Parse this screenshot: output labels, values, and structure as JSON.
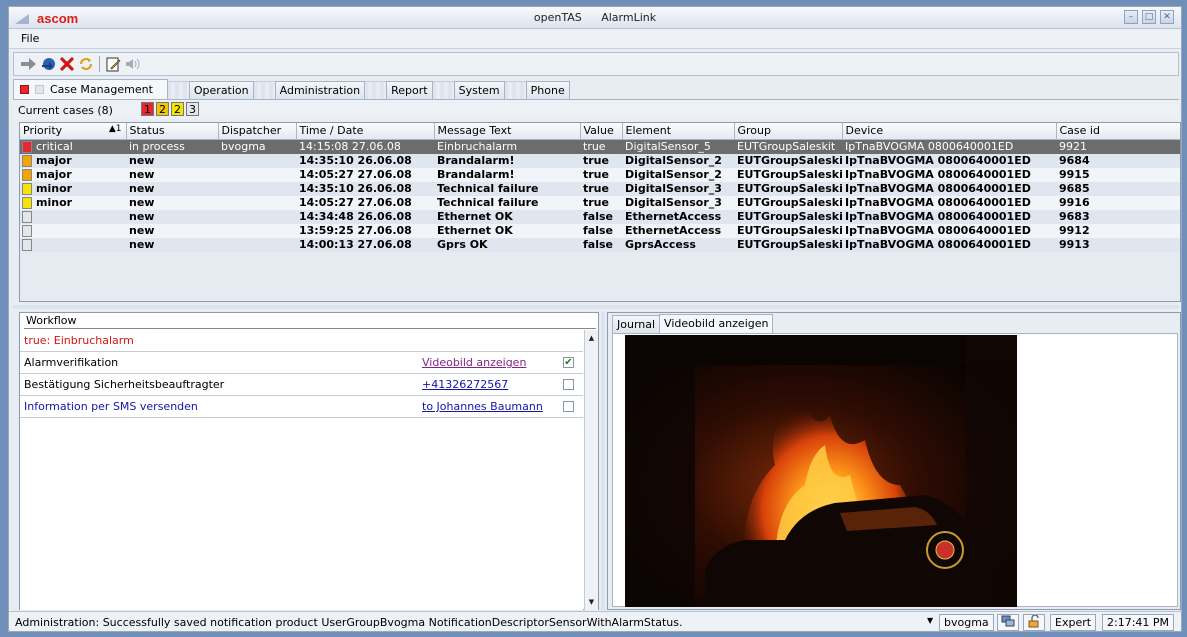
{
  "titlebar": {
    "brand": "ascom",
    "app_name": "openTAS",
    "module_name": "AlarmLink"
  },
  "menu": {
    "file": "File"
  },
  "tabs": [
    "Case Management",
    "Operation",
    "Administration",
    "Report",
    "System",
    "Phone"
  ],
  "current_cases": {
    "label": "Current cases (8)",
    "badges": [
      {
        "text": "1",
        "color": "#e8262d"
      },
      {
        "text": "2",
        "color": "#f4c400"
      },
      {
        "text": "2",
        "color": "#f4e500"
      },
      {
        "text": "3",
        "color": "#e3e6ea"
      }
    ]
  },
  "table": {
    "columns": [
      "Priority",
      "Status",
      "Dispatcher",
      "Time / Date",
      "Message Text",
      "Value",
      "Element",
      "Group",
      "Device",
      "Case id"
    ],
    "sort_indicator": "▲1",
    "rows": [
      {
        "priority": "critical",
        "status": "in process",
        "dispatcher": "bvogma",
        "time": "14:15:08 27.06.08",
        "message": "Einbruchalarm",
        "value": "true",
        "element": "DigitalSensor_5",
        "group": "EUTGroupSaleskit",
        "device": "IpTnaBVOGMA 0800640001ED",
        "case_id": "9921",
        "mark": "#e8262d"
      },
      {
        "priority": "major",
        "status": "new",
        "dispatcher": "",
        "time": "14:35:10 26.06.08",
        "message": "Brandalarm!",
        "value": "true",
        "element": "DigitalSensor_2",
        "group": "EUTGroupSaleskit",
        "device": "IpTnaBVOGMA 0800640001ED",
        "case_id": "9684",
        "mark": "#f2a400"
      },
      {
        "priority": "major",
        "status": "new",
        "dispatcher": "",
        "time": "14:05:27 27.06.08",
        "message": "Brandalarm!",
        "value": "true",
        "element": "DigitalSensor_2",
        "group": "EUTGroupSaleskit",
        "device": "IpTnaBVOGMA 0800640001ED",
        "case_id": "9915",
        "mark": "#f2a400"
      },
      {
        "priority": "minor",
        "status": "new",
        "dispatcher": "",
        "time": "14:35:10 26.06.08",
        "message": "Technical failure",
        "value": "true",
        "element": "DigitalSensor_3",
        "group": "EUTGroupSaleskit",
        "device": "IpTnaBVOGMA 0800640001ED",
        "case_id": "9685",
        "mark": "#f4e500"
      },
      {
        "priority": "minor",
        "status": "new",
        "dispatcher": "",
        "time": "14:05:27 27.06.08",
        "message": "Technical failure",
        "value": "true",
        "element": "DigitalSensor_3",
        "group": "EUTGroupSaleskit",
        "device": "IpTnaBVOGMA 0800640001ED",
        "case_id": "9916",
        "mark": "#f4e500"
      },
      {
        "priority": "",
        "status": "new",
        "dispatcher": "",
        "time": "14:34:48 26.06.08",
        "message": "Ethernet OK",
        "value": "false",
        "element": "EthernetAccess",
        "group": "EUTGroupSaleskit",
        "device": "IpTnaBVOGMA 0800640001ED",
        "case_id": "9683",
        "mark": "#e3e6ea"
      },
      {
        "priority": "",
        "status": "new",
        "dispatcher": "",
        "time": "13:59:25 27.06.08",
        "message": "Ethernet OK",
        "value": "false",
        "element": "EthernetAccess",
        "group": "EUTGroupSaleskit",
        "device": "IpTnaBVOGMA 0800640001ED",
        "case_id": "9912",
        "mark": "#e3e6ea"
      },
      {
        "priority": "",
        "status": "new",
        "dispatcher": "",
        "time": "14:00:13 27.06.08",
        "message": "Gprs OK",
        "value": "false",
        "element": "GprsAccess",
        "group": "EUTGroupSaleskit",
        "device": "IpTnaBVOGMA 0800640001ED",
        "case_id": "9913",
        "mark": "#e3e6ea"
      }
    ]
  },
  "workflow": {
    "title": "Workflow",
    "header": "true: Einbruchalarm",
    "steps": [
      {
        "label": "Alarmverifikation",
        "link": "Videobild anzeigen",
        "checked": true
      },
      {
        "label": "Bestätigung Sicherheitsbeauftragter",
        "link": "+41326272567",
        "checked": false
      },
      {
        "label": "Information per SMS versenden",
        "link": "to Johannes Baumann",
        "checked": false
      }
    ]
  },
  "video": {
    "tabs": [
      "Journal",
      "Videobild anzeigen"
    ]
  },
  "statusbar": {
    "message": "Administration: Successfully saved notification product UserGroupBvogma NotificationDescriptorSensorWithAlarmStatus.",
    "user": "bvogma",
    "mode": "Expert",
    "time": "2:17:41 PM"
  }
}
